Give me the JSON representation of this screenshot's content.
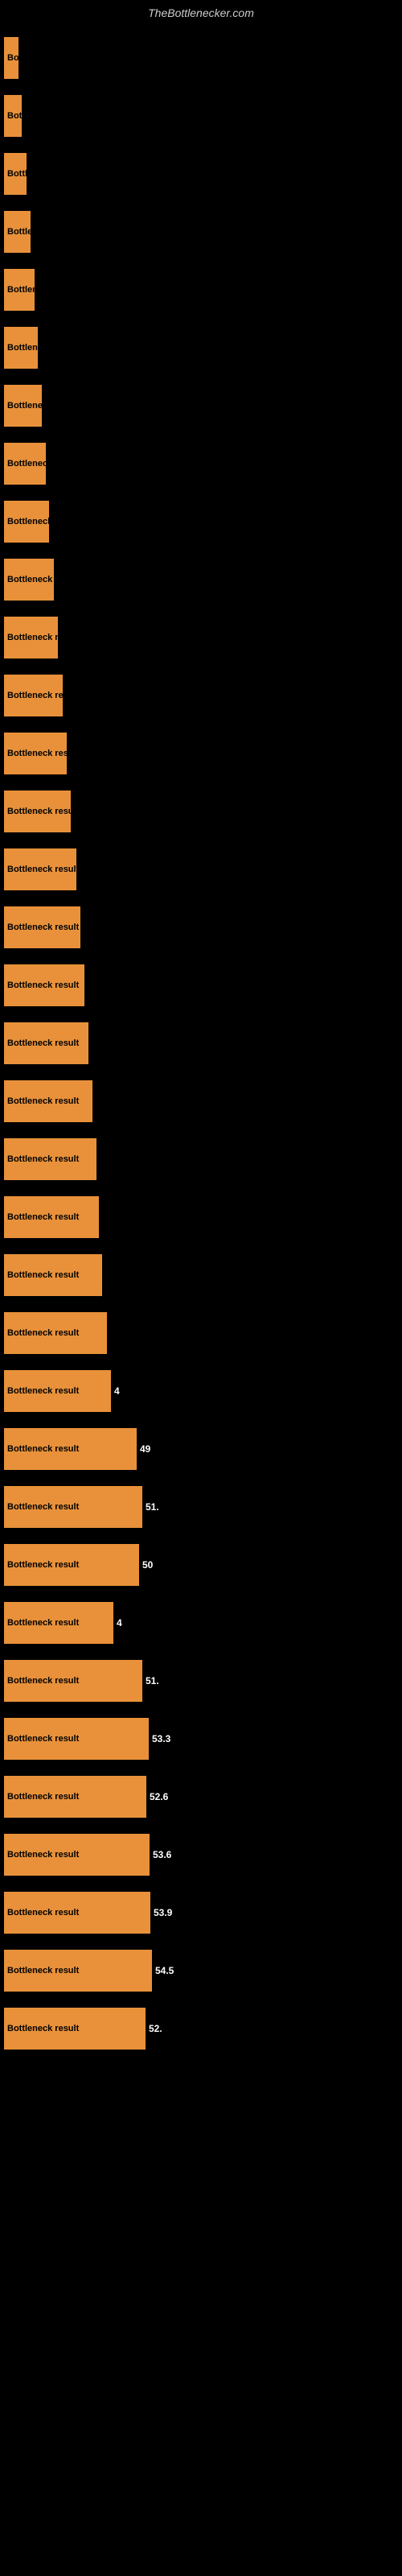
{
  "header": {
    "title": "TheBottlenecker.com"
  },
  "bars": [
    {
      "label": "Bottleneck r",
      "value": null,
      "width": 18
    },
    {
      "label": "Bottleneck r",
      "value": null,
      "width": 22
    },
    {
      "label": "Bottleneck re",
      "value": null,
      "width": 28
    },
    {
      "label": "Bottleneck re",
      "value": null,
      "width": 33
    },
    {
      "label": "Bottleneck re",
      "value": null,
      "width": 38
    },
    {
      "label": "Bottleneck re",
      "value": null,
      "width": 42
    },
    {
      "label": "Bottleneck re",
      "value": null,
      "width": 47
    },
    {
      "label": "Bottleneck re",
      "value": null,
      "width": 52
    },
    {
      "label": "Bottleneck re",
      "value": null,
      "width": 56
    },
    {
      "label": "Bottleneck res",
      "value": null,
      "width": 62
    },
    {
      "label": "Bottleneck res",
      "value": null,
      "width": 67
    },
    {
      "label": "Bottleneck resu",
      "value": null,
      "width": 73
    },
    {
      "label": "Bottleneck resu",
      "value": null,
      "width": 78
    },
    {
      "label": "Bottleneck resu",
      "value": null,
      "width": 83
    },
    {
      "label": "Bottleneck result",
      "value": null,
      "width": 90
    },
    {
      "label": "Bottleneck result",
      "value": null,
      "width": 95
    },
    {
      "label": "Bottleneck result",
      "value": null,
      "width": 100
    },
    {
      "label": "Bottleneck result",
      "value": null,
      "width": 105
    },
    {
      "label": "Bottleneck result",
      "value": null,
      "width": 110
    },
    {
      "label": "Bottleneck result",
      "value": null,
      "width": 115
    },
    {
      "label": "Bottleneck result",
      "value": null,
      "width": 118
    },
    {
      "label": "Bottleneck result",
      "value": null,
      "width": 122
    },
    {
      "label": "Bottleneck result",
      "value": null,
      "width": 128
    },
    {
      "label": "Bottleneck result",
      "value": "4",
      "width": 133
    },
    {
      "label": "Bottleneck result",
      "value": "49",
      "width": 165
    },
    {
      "label": "Bottleneck result",
      "value": "51.",
      "width": 172
    },
    {
      "label": "Bottleneck result",
      "value": "50",
      "width": 168
    },
    {
      "label": "Bottleneck result",
      "value": "4",
      "width": 136
    },
    {
      "label": "Bottleneck result",
      "value": "51.",
      "width": 172
    },
    {
      "label": "Bottleneck result",
      "value": "53.3",
      "width": 180
    },
    {
      "label": "Bottleneck result",
      "value": "52.6",
      "width": 177
    },
    {
      "label": "Bottleneck result",
      "value": "53.6",
      "width": 181
    },
    {
      "label": "Bottleneck result",
      "value": "53.9",
      "width": 182
    },
    {
      "label": "Bottleneck result",
      "value": "54.5",
      "width": 184
    },
    {
      "label": "Bottleneck result",
      "value": "52.",
      "width": 176
    }
  ]
}
